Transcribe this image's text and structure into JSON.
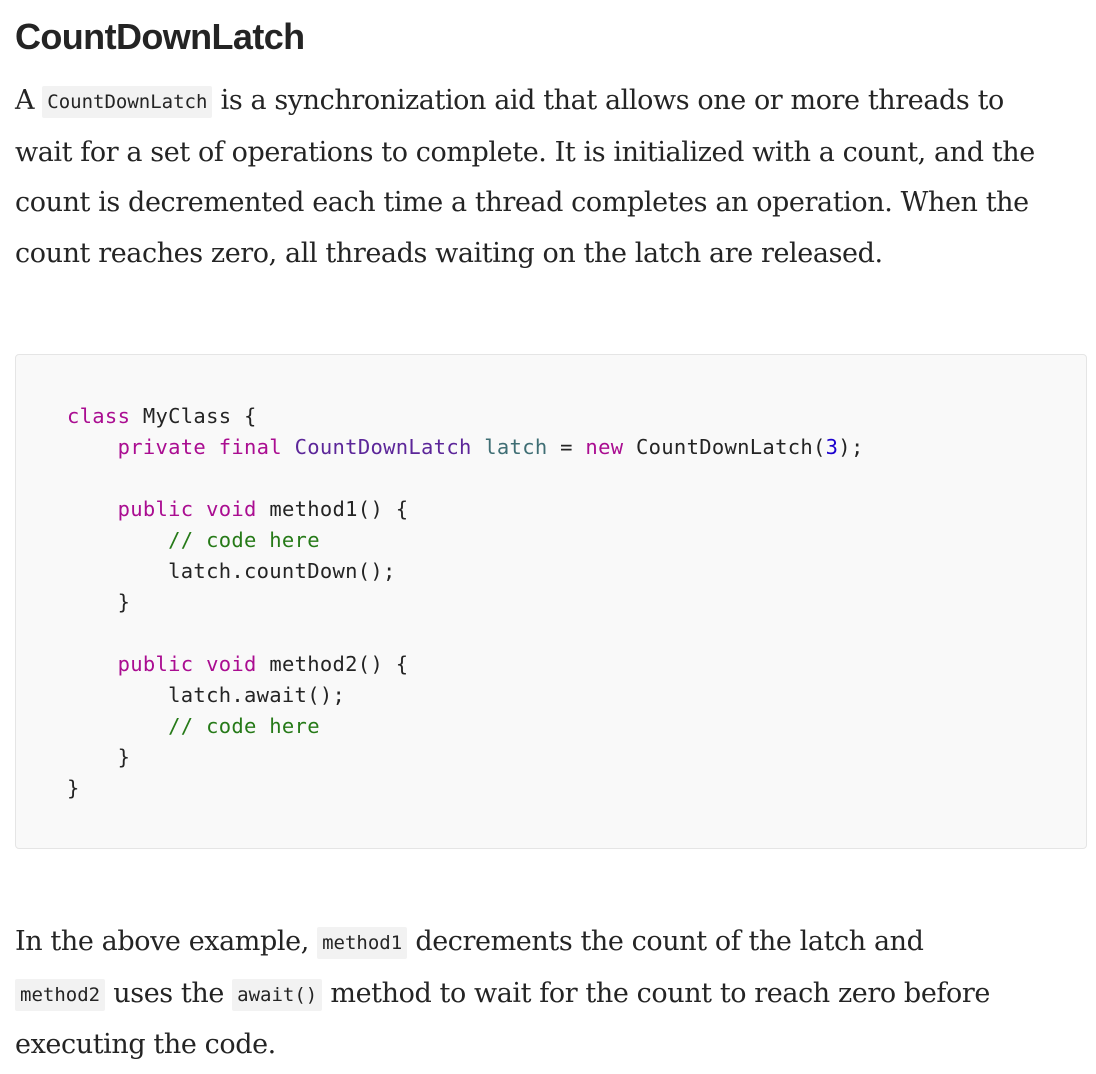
{
  "heading": "CountDownLatch",
  "paragraph1": {
    "t0": "A ",
    "code0": "CountDownLatch",
    "line1": " is a synchronization aid that allows one or more threads to",
    "line2": "wait for a set of operations to complete. It is initialized with a count, and the",
    "line3": "count is decremented each time a thread completes an operation. When the",
    "line4": "count reaches zero, all threads waiting on the latch are released."
  },
  "code": {
    "l1": {
      "kw": "class",
      "rest": " MyClass {"
    },
    "l2": {
      "indent": "    ",
      "kw1": "private",
      "kw2": "final",
      "type": "CountDownLatch",
      "var": "latch",
      "eq": " = ",
      "kw3": "new",
      "ctor": " CountDownLatch(",
      "num": "3",
      "end": ");"
    },
    "l4": {
      "indent": "    ",
      "kw1": "public",
      "kw2": "void",
      "rest": " method1() {"
    },
    "l5": {
      "indent": "        ",
      "comment": "// code here"
    },
    "l6": {
      "indent": "        ",
      "rest": "latch.countDown();"
    },
    "l7": {
      "indent": "    ",
      "rest": "}"
    },
    "l9": {
      "indent": "    ",
      "kw1": "public",
      "kw2": "void",
      "rest": " method2() {"
    },
    "l10": {
      "indent": "        ",
      "rest": "latch.await();"
    },
    "l11": {
      "indent": "        ",
      "comment": "// code here"
    },
    "l12": {
      "indent": "    ",
      "rest": "}"
    },
    "l13": {
      "rest": "}"
    }
  },
  "paragraph2": {
    "t0": "In the above example, ",
    "code0": "method1",
    "t1": " decrements the count of the latch and",
    "code1": "method2",
    "t2": " uses the ",
    "code2": "await()",
    "t3": " method to wait for the count to reach zero before",
    "line3": "executing the code."
  },
  "colors": {
    "keyword": "#aa0d91",
    "type": "#5c2699",
    "variable": "#3f6e74",
    "number": "#1c00cf",
    "comment": "#267a18",
    "code_background": "#f9f9f9"
  }
}
